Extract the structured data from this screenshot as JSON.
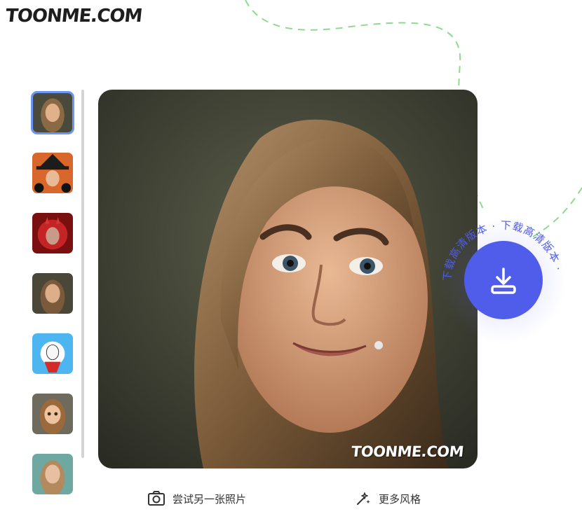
{
  "logo": "TOONME.COM",
  "thumbnails": [
    {
      "name": "thumb-cartoon-portrait",
      "active": true
    },
    {
      "name": "thumb-witch-style",
      "active": false
    },
    {
      "name": "thumb-devil-style",
      "active": false
    },
    {
      "name": "thumb-realistic-style",
      "active": false
    },
    {
      "name": "thumb-sketch-style",
      "active": false
    },
    {
      "name": "thumb-3d-cartoon-style",
      "active": false
    },
    {
      "name": "thumb-painting-style",
      "active": false
    }
  ],
  "main_image": {
    "watermark": "TOONME.COM"
  },
  "download": {
    "ring_text": "下载高清版本 · 下载高清版本 ·"
  },
  "actions": {
    "try_another_label": "尝试另一张照片",
    "more_styles_label": "更多风格"
  },
  "colors": {
    "accent": "#4f5dea",
    "active_border": "#6b95f4",
    "deco_line": "#8edb8e"
  }
}
